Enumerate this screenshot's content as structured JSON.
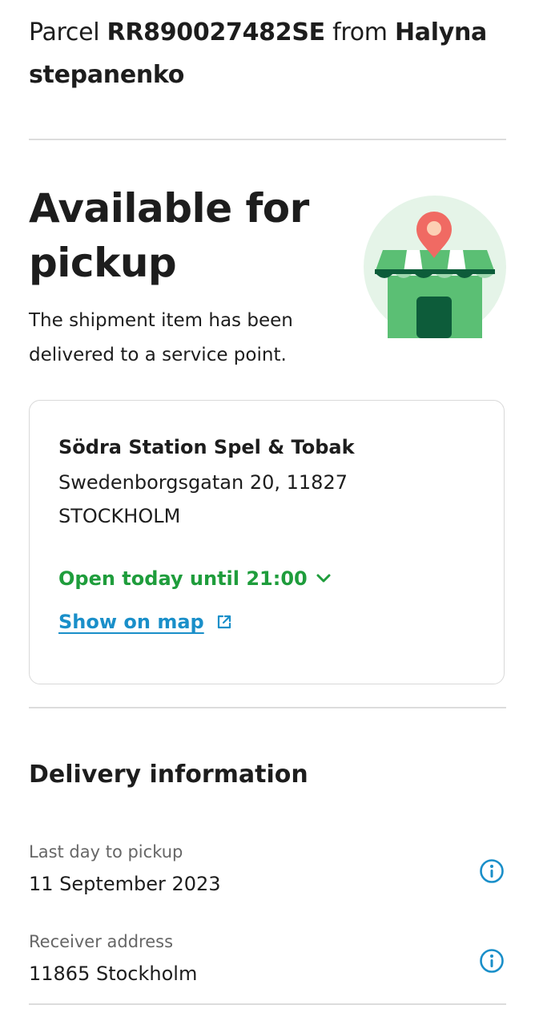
{
  "header": {
    "prefix": "Parcel",
    "tracking_number": "RR890027482SE",
    "from_word": "from",
    "sender_first": "Halyna",
    "sender_last": "stepanenko"
  },
  "status": {
    "title_line1": "Available for",
    "title_line2": "pickup",
    "subtitle_line1": "The shipment item has been",
    "subtitle_line2": "delivered to a service point."
  },
  "illustration": {
    "icon": "service-point-store-icon"
  },
  "service_point": {
    "name": "Södra Station Spel & Tobak",
    "street": "Swedenborgsgatan 20, 11827",
    "city": "STOCKHOLM",
    "opening": "Open today until 21:00",
    "map_link": "Show on map"
  },
  "delivery": {
    "title": "Delivery information",
    "items": [
      {
        "label": "Last day to pickup",
        "value": "11 September 2023"
      },
      {
        "label": "Receiver address",
        "value": "11865 Stockholm"
      }
    ]
  },
  "colors": {
    "open_green": "#1f9d3c",
    "link_blue": "#1a8fc9",
    "store_green": "#5bbf74",
    "store_dark": "#0d5c3a",
    "pin_red": "#f06a63"
  }
}
